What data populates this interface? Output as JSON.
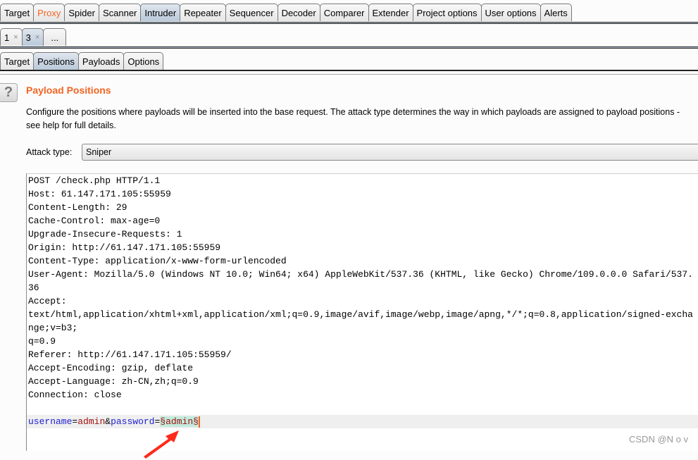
{
  "main_tabs": [
    {
      "label": "Target"
    },
    {
      "label": "Proxy"
    },
    {
      "label": "Spider"
    },
    {
      "label": "Scanner"
    },
    {
      "label": "Intruder"
    },
    {
      "label": "Repeater"
    },
    {
      "label": "Sequencer"
    },
    {
      "label": "Decoder"
    },
    {
      "label": "Comparer"
    },
    {
      "label": "Extender"
    },
    {
      "label": "Project options"
    },
    {
      "label": "User options"
    },
    {
      "label": "Alerts"
    }
  ],
  "attack_tabs": [
    {
      "label": "1"
    },
    {
      "label": "3"
    },
    {
      "label": "..."
    }
  ],
  "close_glyph": "×",
  "sub_tabs": [
    {
      "label": "Target"
    },
    {
      "label": "Positions"
    },
    {
      "label": "Payloads"
    },
    {
      "label": "Options"
    }
  ],
  "section": {
    "help": "?",
    "title": "Payload Positions",
    "description": "Configure the positions where payloads will be inserted into the base request. The attack type determines the way in which payloads are assigned to payload positions - see help for full details.",
    "attack_type_label": "Attack type:",
    "attack_type_value": "Sniper"
  },
  "request_lines": [
    "POST /check.php HTTP/1.1",
    "Host: 61.147.171.105:55959",
    "Content-Length: 29",
    "Cache-Control: max-age=0",
    "Upgrade-Insecure-Requests: 1",
    "Origin: http://61.147.171.105:55959",
    "Content-Type: application/x-www-form-urlencoded",
    "User-Agent: Mozilla/5.0 (Windows NT 10.0; Win64; x64) AppleWebKit/537.36 (KHTML, like Gecko) Chrome/109.0.0.0 Safari/537.36",
    "Accept:",
    "text/html,application/xhtml+xml,application/xml;q=0.9,image/avif,image/webp,image/apng,*/*;q=0.8,application/signed-exchange;v=b3;",
    "q=0.9",
    "Referer: http://61.147.171.105:55959/",
    "Accept-Encoding: gzip, deflate",
    "Accept-Language: zh-CN,zh;q=0.9",
    "Connection: close",
    ""
  ],
  "body": {
    "k1": "username",
    "eq1": "=",
    "v1": "admin",
    "amp": "&",
    "k2": "password",
    "eq2": "=",
    "payload_marker": "§",
    "payload": "admin"
  },
  "colors": {
    "accent": "#f26522",
    "selected_tab": "#b9c9da",
    "payload_highlight": "#c2ebdc"
  },
  "watermark": "CSDN @N o v"
}
